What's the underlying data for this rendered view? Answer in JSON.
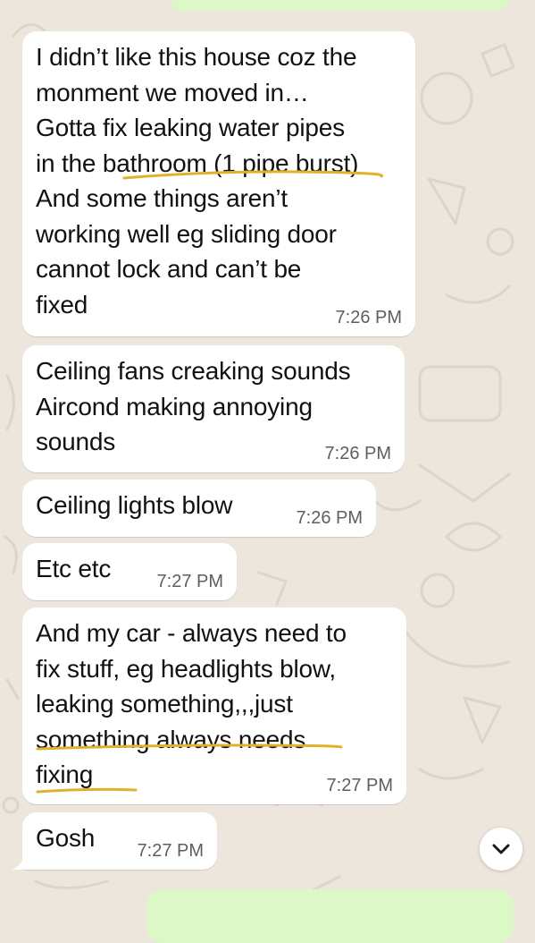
{
  "messages": [
    {
      "text": "I didn’t like this house coz the\nmonment we moved in…\nGotta fix leaking water pipes\nin the bathroom (1 pipe burst)\nAnd some things aren’t\nworking well eg sliding door\ncannot lock and can’t be\nfixed",
      "time": "7:26 PM"
    },
    {
      "text": "Ceiling fans creaking sounds\nAircond making annoying\nsounds",
      "time": "7:26 PM"
    },
    {
      "text": "Ceiling lights blow",
      "time": "7:26 PM"
    },
    {
      "text": "Etc etc",
      "time": "7:27 PM"
    },
    {
      "text": "And my car - always need to\nfix stuff, eg headlights blow,\nleaking something,,,just\nsomething always needs\nfixing",
      "time": "7:27 PM"
    },
    {
      "text": "Gosh",
      "time": "7:27 PM"
    }
  ],
  "icons": {
    "scroll_down": "chevron-down-icon"
  },
  "colors": {
    "wallpaper": "#ece6dc",
    "incoming_bubble": "#ffffff",
    "outgoing_bubble": "#dcf8c6",
    "underline": "#e1b12c",
    "timestamp": "#5e5e5e"
  }
}
